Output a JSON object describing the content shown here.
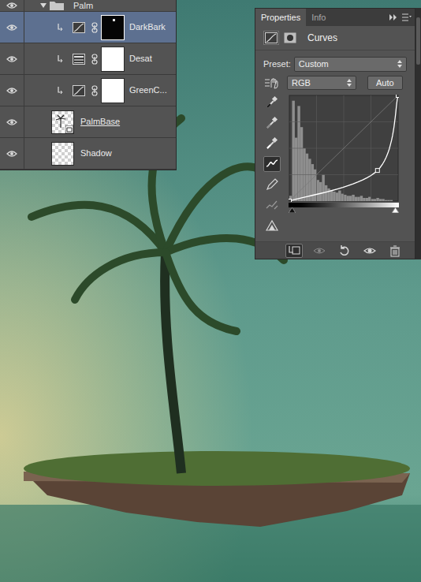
{
  "layers_panel": {
    "layers": [
      {
        "name": "Palm",
        "kind": "group",
        "visible": true,
        "expanded": true,
        "selected": false,
        "clipped": false,
        "clip_base": false
      },
      {
        "name": "DarkBark",
        "kind": "curves",
        "visible": true,
        "selected": true,
        "clipped": true,
        "mask": "dark",
        "clip_base": false
      },
      {
        "name": "Desat",
        "kind": "hue-saturation",
        "visible": true,
        "selected": false,
        "clipped": true,
        "mask": "light",
        "clip_base": false
      },
      {
        "name": "GreenC...",
        "kind": "curves",
        "visible": true,
        "selected": false,
        "clipped": true,
        "mask": "light",
        "clip_base": false
      },
      {
        "name": "PalmBase",
        "kind": "smart-object",
        "visible": true,
        "selected": false,
        "clipped": false,
        "clip_base": true
      },
      {
        "name": "Shadow",
        "kind": "layer",
        "visible": true,
        "selected": false,
        "clipped": false,
        "clip_base": false
      }
    ]
  },
  "properties_panel": {
    "tabs": [
      {
        "label": "Properties",
        "selected": true
      },
      {
        "label": "Info",
        "selected": false
      }
    ],
    "title": "Curves",
    "preset": {
      "label": "Preset:",
      "value": "Custom"
    },
    "channel": "RGB",
    "auto_button": "Auto",
    "tools": [
      {
        "kind": "eyedropper-black",
        "selected": false
      },
      {
        "kind": "eyedropper-gray",
        "selected": false
      },
      {
        "kind": "eyedropper-white",
        "selected": false
      },
      {
        "kind": "curve",
        "selected": true
      },
      {
        "kind": "pencil",
        "selected": false
      },
      {
        "kind": "smooth",
        "selected": false
      },
      {
        "kind": "clipping",
        "selected": false
      }
    ],
    "histogram": [
      0.05,
      0.95,
      0.6,
      0.9,
      0.7,
      0.5,
      0.45,
      0.4,
      0.35,
      0.3,
      0.2,
      0.18,
      0.25,
      0.15,
      0.12,
      0.1,
      0.09,
      0.08,
      0.1,
      0.07,
      0.06,
      0.05,
      0.05,
      0.06,
      0.04,
      0.04,
      0.05,
      0.03,
      0.03,
      0.04,
      0.02,
      0.02,
      0.03,
      0.02,
      0.02,
      0.01,
      0.01,
      0.01,
      0.0,
      0.0
    ],
    "curve_points": [
      [
        0,
        0
      ],
      [
        0.81,
        0.29
      ],
      [
        1,
        1
      ]
    ],
    "footer_buttons": [
      {
        "kind": "clip",
        "selected": true
      },
      {
        "kind": "view-previous",
        "selected": false
      },
      {
        "kind": "reset",
        "selected": false
      },
      {
        "kind": "visibility",
        "selected": false
      },
      {
        "kind": "delete",
        "selected": false
      }
    ]
  }
}
